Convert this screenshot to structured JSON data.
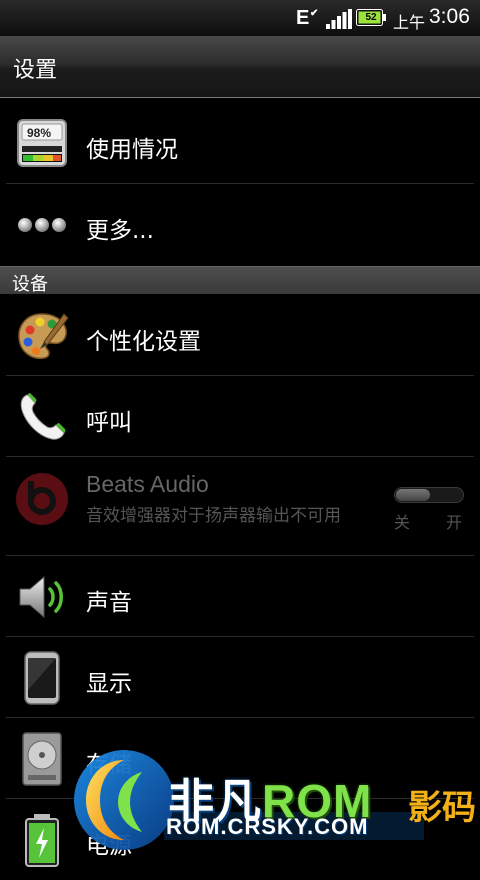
{
  "status_bar": {
    "network_type": "E",
    "battery_level": "52",
    "am_pm": "上午",
    "time": "3:06"
  },
  "app_bar": {
    "title": "设置"
  },
  "top_items": [
    {
      "label": "使用情况",
      "icon": "usage-meter-icon"
    },
    {
      "label": "更多...",
      "icon": "more-dots-icon"
    }
  ],
  "section": {
    "title": "设备"
  },
  "device_items": [
    {
      "label": "个性化设置",
      "icon": "palette-icon"
    },
    {
      "label": "呼叫",
      "icon": "phone-icon"
    },
    {
      "label": "声音",
      "icon": "speaker-icon"
    },
    {
      "label": "显示",
      "icon": "display-icon"
    },
    {
      "label": "存储",
      "icon": "storage-icon"
    },
    {
      "label": "电源",
      "icon": "battery-icon"
    }
  ],
  "beats": {
    "title": "Beats Audio",
    "summary": "音效增强器对于扬声器输出不可用",
    "toggle_off": "关",
    "toggle_on": "开",
    "enabled": false
  },
  "watermark": {
    "brand_cn": "非凡",
    "brand_rom": "ROM",
    "url": "ROM.CRSKY.COM",
    "right_text": "影码"
  },
  "colors": {
    "background": "#000000",
    "accent_green": "#7fe24a",
    "watermark_blue": "#0a4a8a",
    "disabled_text": "#666666"
  }
}
